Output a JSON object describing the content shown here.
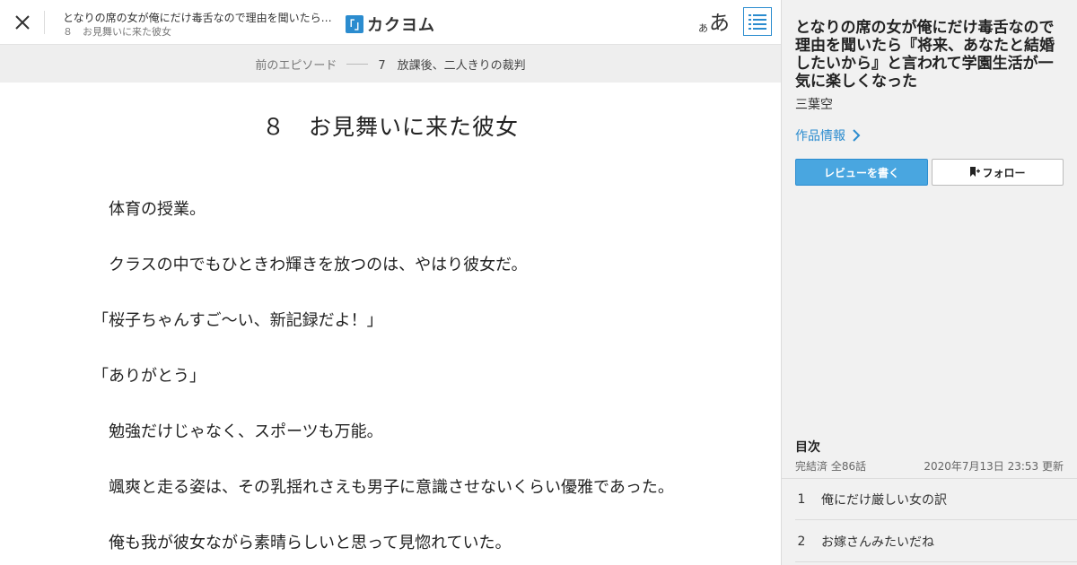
{
  "header": {
    "work_title": "となりの席の女が俺にだけ毒舌なので理由を聞いたら『将来、あなたと結婚したいから』と言われて学園生活が一気に楽しくなった",
    "episode_subtitle": "８　お見舞いに来た彼女",
    "logo_mark": "「」",
    "logo_text": "カクヨム",
    "font_small": "あ",
    "font_large": "あ",
    "icons": {
      "close": "close-icon",
      "toc": "list-icon"
    }
  },
  "prev_episode": {
    "label": "前のエピソード",
    "title": "7　放課後、二人きりの裁判"
  },
  "episode": {
    "title": "８　お見舞いに来た彼女",
    "paragraphs": [
      "　体育の授業。",
      "　クラスの中でもひときわ輝きを放つのは、やはり彼女だ。",
      "「桜子ちゃんすご～い、新記録だよ！」",
      "「ありがとう」",
      "　勉強だけじゃなく、スポーツも万能。",
      "　颯爽と走る姿は、その乳揺れさえも男子に意識させないくらい優雅であった。",
      "　俺も我が彼女ながら素晴らしいと思って見惚れていた。"
    ]
  },
  "panel": {
    "work_title": "となりの席の女が俺にだけ毒舌なので理由を聞いたら『将来、あなたと結婚したいから』と言われて学園生活が一気に楽しくなった",
    "author": "三葉空",
    "work_info_link": "作品情報",
    "review_button": "レビューを書く",
    "follow_button": "フォロー",
    "toc_heading": "目次",
    "status": "完結済 全86話",
    "updated": "2020年7月13日 23:53 更新",
    "toc_items": [
      {
        "num": "1",
        "title": "俺にだけ厳しい女の訳"
      },
      {
        "num": "2",
        "title": "お嫁さんみたいだね"
      }
    ],
    "colors": {
      "accent": "#2b8ccf",
      "button_fill": "#49a6e0"
    }
  }
}
